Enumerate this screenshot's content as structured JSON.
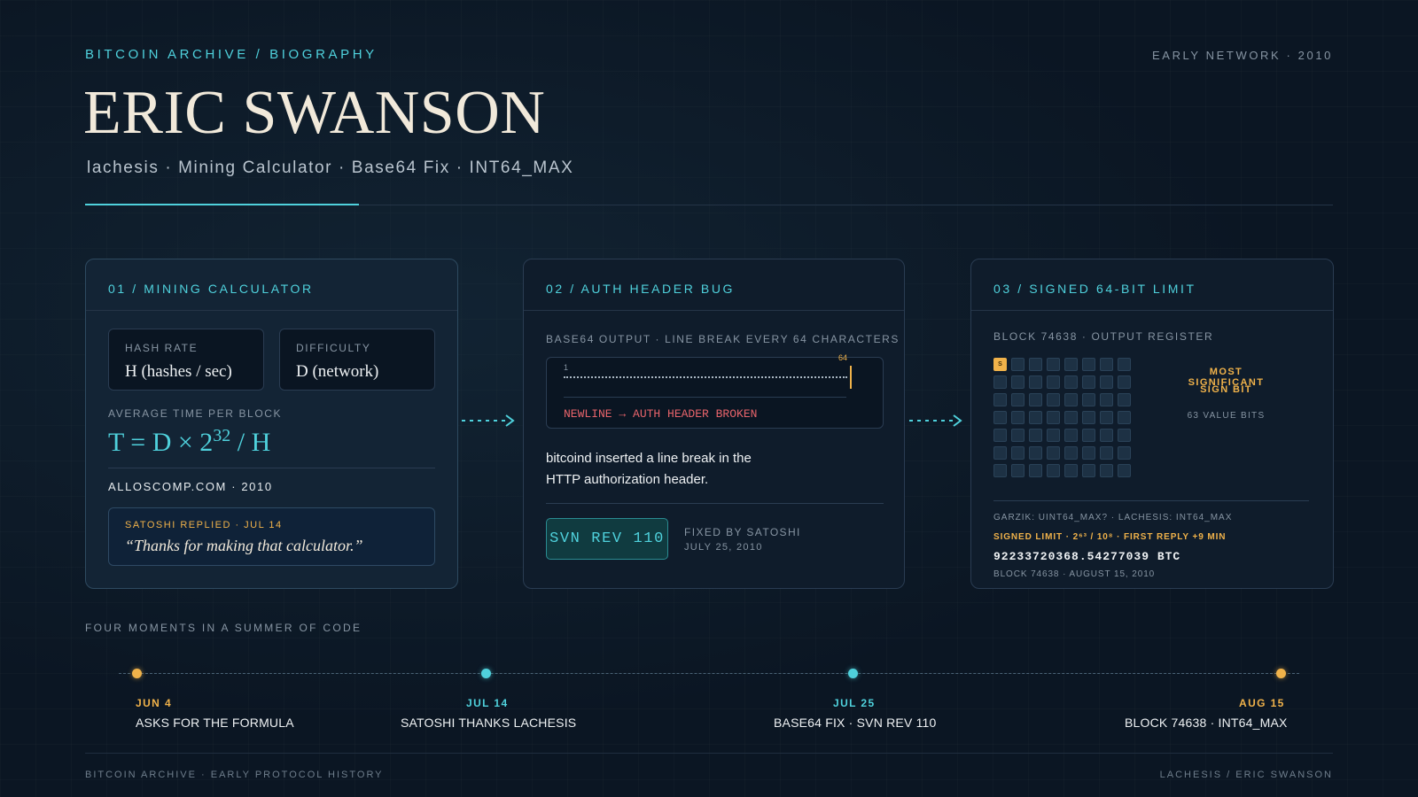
{
  "header": {
    "eyebrow": "BITCOIN ARCHIVE / BIOGRAPHY",
    "era": "EARLY NETWORK · 2010",
    "title": "ERIC SWANSON",
    "subtitle": "lachesis · Mining Calculator · Base64 Fix · INT64_MAX"
  },
  "colors": {
    "accent_cyan": "#4fd1dc",
    "accent_gold": "#f0b24a",
    "error_red": "#e8646b",
    "background": "#0b1623"
  },
  "card1": {
    "title": "01 / MINING CALCULATOR",
    "hash_rate_label": "HASH RATE",
    "hash_rate_value": "H (hashes / sec)",
    "difficulty_label": "DIFFICULTY",
    "difficulty_value": "D (network)",
    "avg_label": "AVERAGE TIME PER BLOCK",
    "formula_prefix": "T = D × 2",
    "formula_exp": "32",
    "formula_suffix": " / H",
    "site": "ALLOSCOMP.COM · 2010",
    "reply_label": "SATOSHI REPLIED · JUL 14",
    "reply_quote": "“Thanks for making that calculator.”"
  },
  "card2": {
    "title": "02 / AUTH HEADER BUG",
    "b64_label": "BASE64 OUTPUT · LINE BREAK EVERY 64 CHARACTERS",
    "tick_start": "1",
    "tick_end": "64",
    "error_text": "NEWLINE → AUTH HEADER BROKEN",
    "description": "bitcoind inserted a line break in the HTTP authorization header.",
    "svn_label": "SVN REV 110",
    "fixed_by": "FIXED BY SATOSHI",
    "fixed_date": "JULY 25, 2010"
  },
  "card3": {
    "title": "03 / SIGNED 64-BIT LIMIT",
    "register_label": "BLOCK 74638 · OUTPUT REGISTER",
    "sign_cell": "S",
    "msb_line1": "MOST SIGNIFICANT",
    "msb_line2": "SIGN BIT",
    "value_bits": "63 VALUE BITS",
    "garzik": "GARZIK: UINT64_MAX? · LACHESIS: INT64_MAX",
    "signed_limit": "SIGNED LIMIT · 2⁶³ / 10⁸ · FIRST REPLY +9 MIN",
    "btc_value": "92233720368.54277039 BTC",
    "block_date": "BLOCK 74638 · AUGUST 15, 2010"
  },
  "timeline": {
    "label": "FOUR MOMENTS IN A SUMMER OF CODE",
    "moments": [
      {
        "date": "JUN 4",
        "text": "ASKS FOR THE FORMULA",
        "color": "gold"
      },
      {
        "date": "JUL 14",
        "text": "SATOSHI THANKS LACHESIS",
        "color": "cyan"
      },
      {
        "date": "JUL 25",
        "text": "BASE64 FIX · SVN REV 110",
        "color": "cyan"
      },
      {
        "date": "AUG 15",
        "text": "BLOCK 74638 · INT64_MAX",
        "color": "gold"
      }
    ]
  },
  "footer": {
    "left": "BITCOIN ARCHIVE · EARLY PROTOCOL HISTORY",
    "right": "LACHESIS / ERIC SWANSON"
  }
}
